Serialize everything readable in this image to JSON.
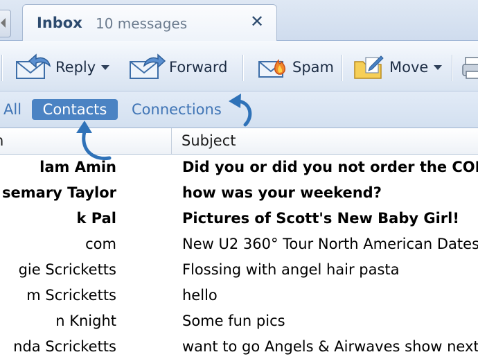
{
  "tab": {
    "title": "Inbox",
    "count": "10 messages",
    "close_glyph": "✕"
  },
  "toolbar": {
    "reply": "Reply",
    "forward": "Forward",
    "spam": "Spam",
    "move": "Move"
  },
  "filters": {
    "all": "All",
    "contacts": "Contacts",
    "connections": "Connections",
    "selected": "Contacts"
  },
  "columns": {
    "from": "n",
    "subject": "Subject"
  },
  "messages": [
    {
      "from": "lam Amin",
      "subject": "Did you or did you not order the COI",
      "unread": true
    },
    {
      "from": "semary Taylor",
      "subject": "how was your weekend?",
      "unread": true
    },
    {
      "from": "k Pal",
      "subject": "Pictures of Scott's New Baby Girl!",
      "unread": true
    },
    {
      "from": "com",
      "subject": "New U2 360° Tour North American Dates",
      "unread": false
    },
    {
      "from": "gie Scricketts",
      "subject": "Flossing with angel hair pasta",
      "unread": false
    },
    {
      "from": "m Scricketts",
      "subject": "hello",
      "unread": false
    },
    {
      "from": "n Knight",
      "subject": "Some fun pics",
      "unread": false
    },
    {
      "from": "nda Scricketts",
      "subject": "want to go Angels & Airwaves show next",
      "unread": false
    }
  ],
  "colors": {
    "accent": "#4b83c3",
    "link": "#3f74b5",
    "callout": "#2f72b8"
  },
  "icons": {
    "reply": "envelope-reply-icon",
    "forward": "envelope-forward-icon",
    "spam": "envelope-spam-icon",
    "move": "folder-move-icon",
    "print": "printer-icon"
  }
}
